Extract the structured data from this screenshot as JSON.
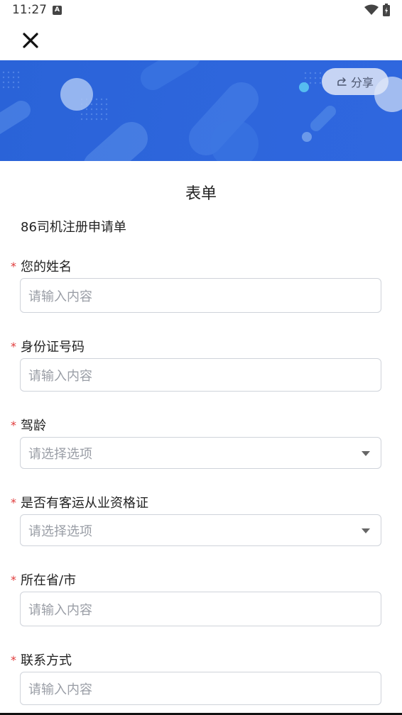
{
  "status_bar": {
    "time": "11:27",
    "a_icon": "A"
  },
  "toolbar": {
    "close_icon": "close-icon"
  },
  "banner": {
    "share_label": "分享"
  },
  "form": {
    "title": "表单",
    "description": "86司机注册申请单",
    "required_mark": "*",
    "fields": [
      {
        "label": "您的姓名",
        "placeholder": "请输入内容",
        "type": "input"
      },
      {
        "label": "身份证号码",
        "placeholder": "请输入内容",
        "type": "input"
      },
      {
        "label": "驾龄",
        "placeholder": "请选择选项",
        "type": "select"
      },
      {
        "label": "是否有客运从业资格证",
        "placeholder": "请选择选项",
        "type": "select"
      },
      {
        "label": "所在省/市",
        "placeholder": "请输入内容",
        "type": "input"
      },
      {
        "label": "联系方式",
        "placeholder": "请输入内容",
        "type": "input"
      }
    ]
  },
  "colors": {
    "banner": "#2e66dc",
    "required": "#e03a3a",
    "border": "#cfd3da",
    "placeholder": "#9a9ea6"
  }
}
